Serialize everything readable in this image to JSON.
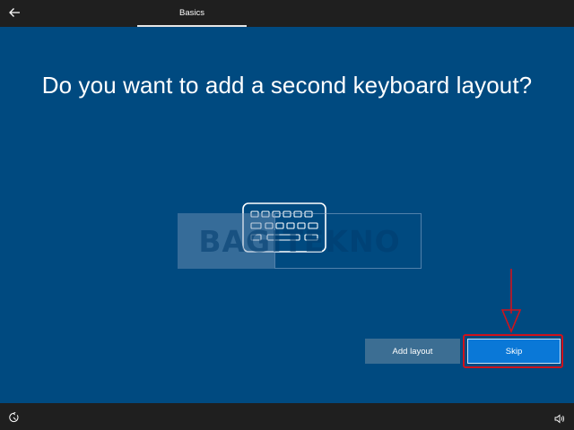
{
  "header": {
    "back_icon": "back-arrow-icon",
    "tab_label": "Basics"
  },
  "main": {
    "heading": "Do you want to add a second keyboard layout?",
    "illustration_icon": "keyboard-icon",
    "watermark": "BAGITEKNO",
    "background_color": "#004a80"
  },
  "buttons": {
    "add_layout_label": "Add layout",
    "skip_label": "Skip",
    "annotation_color": "#d0121b"
  },
  "footer": {
    "left_icon": "ease-of-access-icon",
    "right_icon": "volume-icon"
  }
}
